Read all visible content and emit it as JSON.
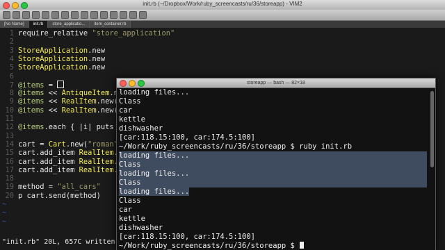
{
  "window": {
    "title": "init.rb (~/Dropbox/Work/ruby_screencasts/ru/36/storeapp) - VIM2"
  },
  "toolbar": {
    "icons": [
      "open-icon",
      "save-icon",
      "save-all-icon",
      "print-icon",
      "undo-icon",
      "redo-icon",
      "cut-icon",
      "copy-icon",
      "paste-icon",
      "find-icon",
      "find-next-icon",
      "build-icon",
      "run-icon",
      "radiation-icon",
      "help-icon"
    ]
  },
  "tabs": [
    {
      "label": "[No Name]"
    },
    {
      "label": "init.rb"
    },
    {
      "label": "store_applicatio..."
    },
    {
      "label": "item_container.rb"
    }
  ],
  "editor": {
    "lines": [
      {
        "num": "1",
        "parts": [
          {
            "t": "require_relative ",
            "c": "plain"
          },
          {
            "t": "\"store_application\"",
            "c": "str"
          }
        ]
      },
      {
        "num": "2",
        "parts": []
      },
      {
        "num": "3",
        "parts": [
          {
            "t": "StoreApplication",
            "c": "class"
          },
          {
            "t": ".new",
            "c": "plain"
          }
        ]
      },
      {
        "num": "4",
        "parts": [
          {
            "t": "StoreApplication",
            "c": "class"
          },
          {
            "t": ".new",
            "c": "plain"
          }
        ]
      },
      {
        "num": "5",
        "parts": [
          {
            "t": "StoreApplication",
            "c": "class"
          },
          {
            "t": ".new",
            "c": "plain"
          }
        ]
      },
      {
        "num": "6",
        "parts": []
      },
      {
        "num": "7",
        "parts": [
          {
            "t": "@items",
            "c": "ivar"
          },
          {
            "t": " = ",
            "c": "plain"
          }
        ],
        "box": true
      },
      {
        "num": "8",
        "parts": [
          {
            "t": "@items",
            "c": "ivar"
          },
          {
            "t": " << ",
            "c": "plain"
          },
          {
            "t": "AntiqueItem",
            "c": "class"
          },
          {
            "t": ".new(",
            "c": "plain"
          }
        ]
      },
      {
        "num": "9",
        "parts": [
          {
            "t": "@items",
            "c": "ivar"
          },
          {
            "t": " << ",
            "c": "plain"
          },
          {
            "t": "RealItem",
            "c": "class"
          },
          {
            "t": ".new({:w",
            "c": "plain"
          }
        ]
      },
      {
        "num": "10",
        "parts": [
          {
            "t": "@items",
            "c": "ivar"
          },
          {
            "t": " << ",
            "c": "plain"
          },
          {
            "t": "RealItem",
            "c": "class"
          },
          {
            "t": ".new({:w",
            "c": "plain"
          }
        ]
      },
      {
        "num": "11",
        "parts": []
      },
      {
        "num": "12",
        "parts": [
          {
            "t": "@items",
            "c": "ivar"
          },
          {
            "t": ".each { |i| puts i.n",
            "c": "plain"
          }
        ]
      },
      {
        "num": "13",
        "parts": []
      },
      {
        "num": "14",
        "parts": [
          {
            "t": "cart = ",
            "c": "plain"
          },
          {
            "t": "Cart",
            "c": "class"
          },
          {
            "t": ".new(",
            "c": "plain"
          },
          {
            "t": "\"roman\"",
            "c": "str"
          },
          {
            "t": ")",
            "c": "plain"
          }
        ]
      },
      {
        "num": "15",
        "parts": [
          {
            "t": "cart.add_item ",
            "c": "plain"
          },
          {
            "t": "RealItem",
            "c": "class"
          },
          {
            "t": ".new",
            "c": "plain"
          }
        ]
      },
      {
        "num": "16",
        "parts": [
          {
            "t": "cart.add_item ",
            "c": "plain"
          },
          {
            "t": "RealItem",
            "c": "class"
          },
          {
            "t": ".new",
            "c": "plain"
          }
        ]
      },
      {
        "num": "17",
        "parts": [
          {
            "t": "cart.add_item ",
            "c": "plain"
          },
          {
            "t": "RealItem",
            "c": "class"
          },
          {
            "t": ".new",
            "c": "plain"
          }
        ]
      },
      {
        "num": "18",
        "parts": []
      },
      {
        "num": "19",
        "parts": [
          {
            "t": "method = ",
            "c": "plain"
          },
          {
            "t": "\"all_cars\"",
            "c": "str"
          }
        ]
      },
      {
        "num": "20",
        "parts": [
          {
            "t": "p cart.send(method)",
            "c": "plain"
          }
        ]
      }
    ],
    "tildes": [
      "~",
      "~",
      "~"
    ],
    "status": "\"init.rb\" 20L, 657C written"
  },
  "terminal": {
    "title": "storeapp — bash — 82×18",
    "lines": [
      {
        "text": "loading files...",
        "sel": false
      },
      {
        "text": "Class",
        "sel": false
      },
      {
        "text": "car",
        "sel": false
      },
      {
        "text": "kettle",
        "sel": false
      },
      {
        "text": "dishwasher",
        "sel": false
      },
      {
        "text": "[car:118.15:100, car:174.5:100]",
        "sel": false
      },
      {
        "text": "~/Work/ruby_screencasts/ru/36/storeapp $ ruby init.rb",
        "sel": false
      },
      {
        "text": "loading files...",
        "sel": true,
        "full": true
      },
      {
        "text": "Class",
        "sel": true,
        "full": true
      },
      {
        "text": "loading files...",
        "sel": true,
        "full": true
      },
      {
        "text": "Class",
        "sel": true,
        "full": true
      },
      {
        "text": "loading files...",
        "sel": true,
        "full": false
      },
      {
        "text": "Class",
        "sel": false
      },
      {
        "text": "car",
        "sel": false
      },
      {
        "text": "kettle",
        "sel": false
      },
      {
        "text": "dishwasher",
        "sel": false
      },
      {
        "text": "[car:118.15:100, car:174.5:100]",
        "sel": false
      },
      {
        "text": "~/Work/ruby_screencasts/ru/36/storeapp $ ",
        "sel": false,
        "cursor": true
      }
    ]
  },
  "colors": {
    "editor_bg": "#1a1a1a",
    "class": "#f3ea5a",
    "string": "#9b9b6a",
    "ivar": "#b7cd7a",
    "selection": "#3f4b5e",
    "close": "#ff5f57",
    "minimize": "#febc2e",
    "zoom": "#28c840"
  }
}
